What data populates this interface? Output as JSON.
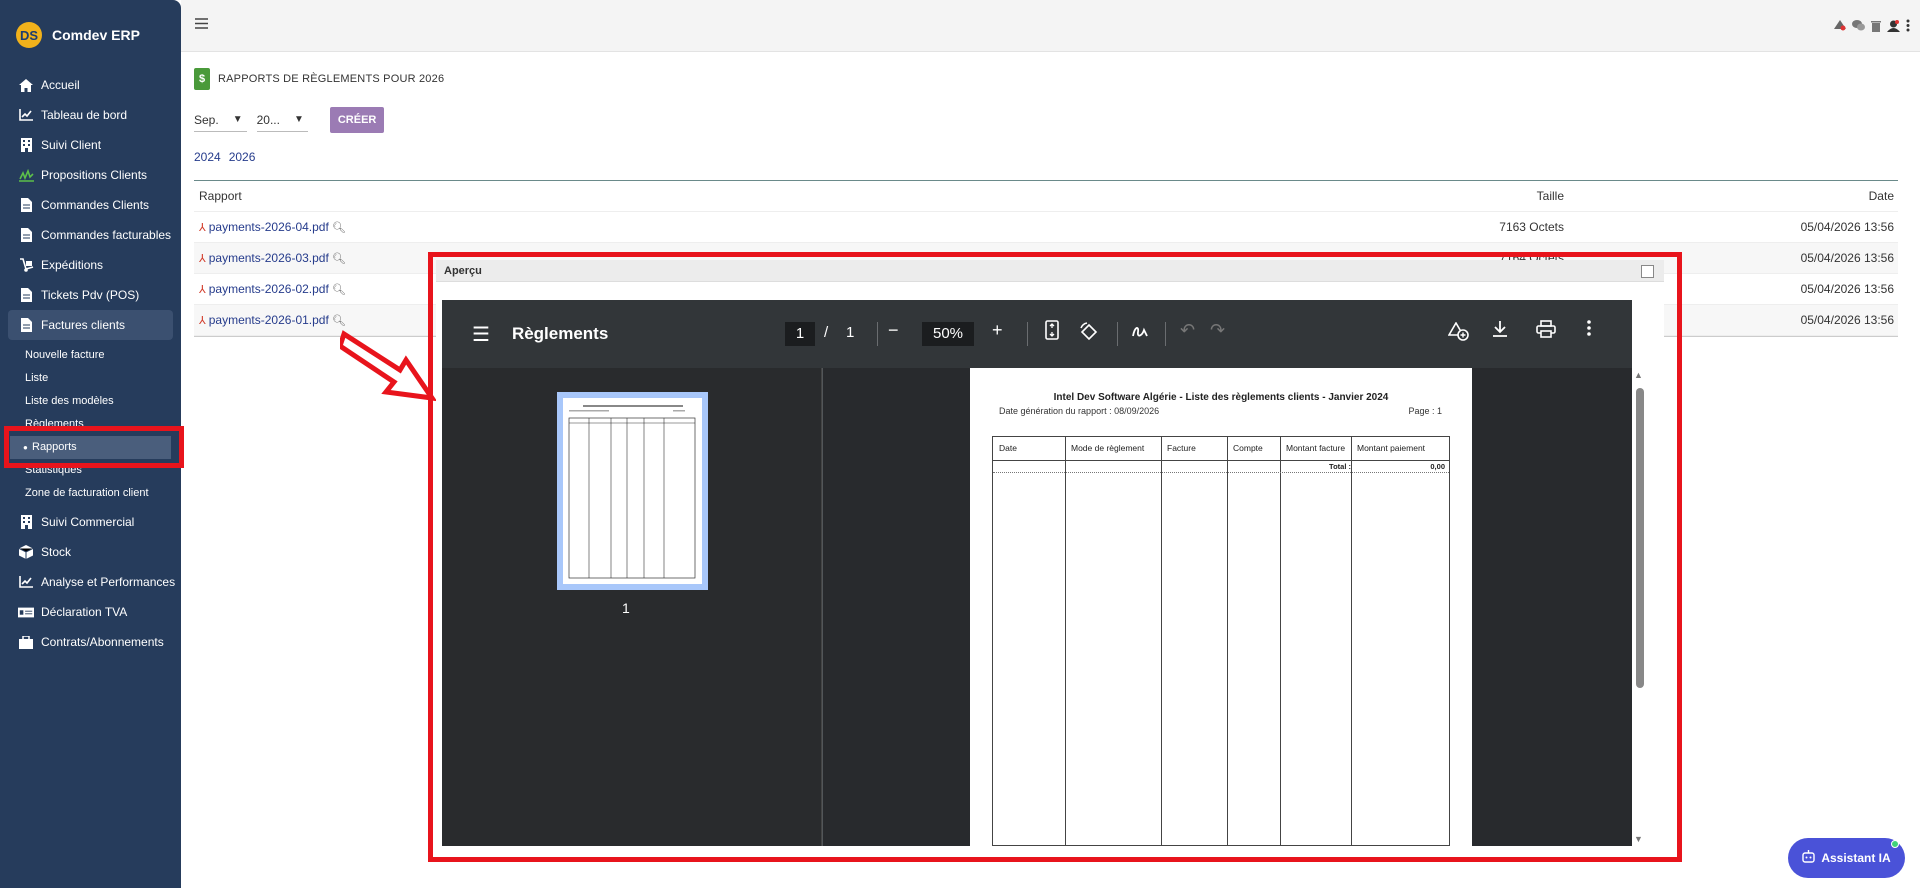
{
  "app": {
    "name": "Comdev ERP",
    "logo_text": "DS"
  },
  "sidebar": {
    "items": [
      {
        "label": "Accueil",
        "icon": "home-icon"
      },
      {
        "label": "Tableau de bord",
        "icon": "chart-line-icon"
      },
      {
        "label": "Suivi Client",
        "icon": "building-icon"
      },
      {
        "label": "Propositions Clients",
        "icon": "signature-icon"
      },
      {
        "label": "Commandes Clients",
        "icon": "document-icon"
      },
      {
        "label": "Commandes facturables",
        "icon": "document-icon"
      },
      {
        "label": "Expéditions",
        "icon": "dolly-icon"
      },
      {
        "label": "Tickets Pdv (POS)",
        "icon": "document-icon"
      },
      {
        "label": "Factures clients",
        "icon": "document-icon"
      }
    ],
    "sub_items": [
      "Nouvelle facture",
      "Liste",
      "Liste des modèles",
      "Règlements",
      "Rapports",
      "Statistiques",
      "Zone de facturation client"
    ],
    "items_after": [
      {
        "label": "Suivi Commercial",
        "icon": "building-icon"
      },
      {
        "label": "Stock",
        "icon": "box-icon"
      },
      {
        "label": "Analyse et Performances",
        "icon": "chart-line-icon"
      },
      {
        "label": "Déclaration TVA",
        "icon": "money-icon"
      },
      {
        "label": "Contrats/Abonnements",
        "icon": "briefcase-icon"
      }
    ]
  },
  "page": {
    "title": "RAPPORTS DE RÈGLEMENTS POUR 2026",
    "month_select": "Sep.",
    "year_select": "20...",
    "create_label": "CRÉER",
    "years": [
      "2024",
      "2026"
    ]
  },
  "table": {
    "headers": {
      "report": "Rapport",
      "size": "Taille",
      "date": "Date"
    },
    "rows": [
      {
        "file": "payments-2026-04.pdf",
        "size": "7163 Octets",
        "date": "05/04/2026 13:56"
      },
      {
        "file": "payments-2026-03.pdf",
        "size": "7164 Octets",
        "date": "05/04/2026 13:56"
      },
      {
        "file": "payments-2026-02.pdf",
        "size": "",
        "date": "05/04/2026 13:56"
      },
      {
        "file": "payments-2026-01.pdf",
        "size": "",
        "date": "05/04/2026 13:56"
      }
    ]
  },
  "dialog": {
    "title": "Aperçu",
    "viewer": {
      "doc_title": "Règlements",
      "page_current": "1",
      "page_sep": "/",
      "page_total": "1",
      "zoom": "50%",
      "thumb_label": "1"
    },
    "report": {
      "heading": "Intel Dev Software Algérie - Liste des règlements clients - Janvier 2024",
      "generated": "Date génération du rapport : 08/09/2026",
      "page": "Page : 1",
      "columns": [
        "Date",
        "Mode de règlement",
        "Facture",
        "Compte",
        "Montant facture",
        "Montant paiement"
      ],
      "total_label": "Total :",
      "total_value": "0,00"
    }
  },
  "assistant": {
    "label": "Assistant IA"
  },
  "colors": {
    "sidebar": "#263c5c",
    "accent": "#9b7bb4",
    "highlight": "#e8141c",
    "assistant": "#4a52d8"
  }
}
